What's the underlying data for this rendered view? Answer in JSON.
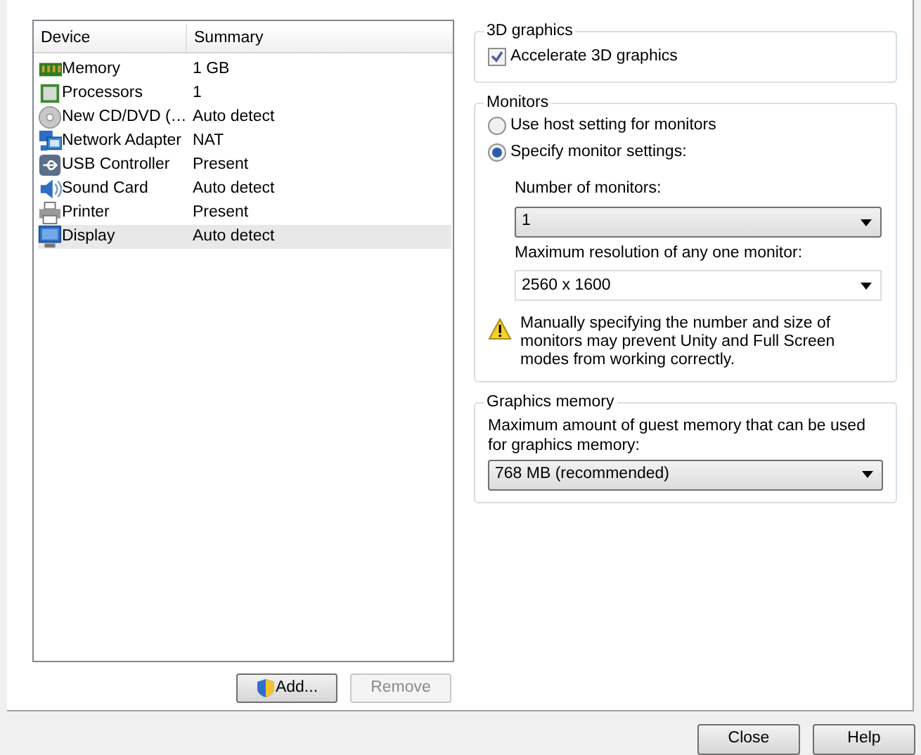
{
  "device_list": {
    "columns": [
      "Device",
      "Summary"
    ],
    "rows": [
      {
        "kind": "memory",
        "device": "Memory",
        "summary": "1 GB",
        "selected": false
      },
      {
        "kind": "processor",
        "device": "Processors",
        "summary": "1",
        "selected": false
      },
      {
        "kind": "cd",
        "device": "New CD/DVD (…",
        "summary": "Auto detect",
        "selected": false
      },
      {
        "kind": "network",
        "device": "Network Adapter",
        "summary": "NAT",
        "selected": false
      },
      {
        "kind": "usb",
        "device": "USB Controller",
        "summary": "Present",
        "selected": false
      },
      {
        "kind": "sound",
        "device": "Sound Card",
        "summary": "Auto detect",
        "selected": false
      },
      {
        "kind": "printer",
        "device": "Printer",
        "summary": "Present",
        "selected": false
      },
      {
        "kind": "display",
        "device": "Display",
        "summary": "Auto detect",
        "selected": true
      }
    ]
  },
  "list_buttons": [
    {
      "label": "Add...",
      "shield": true,
      "disabled": false
    },
    {
      "label": "Remove",
      "shield": false,
      "disabled": true
    }
  ],
  "graphics_3d": {
    "title": "3D graphics",
    "accelerate": {
      "label": "Accelerate 3D graphics",
      "checked": true
    }
  },
  "monitors": {
    "title": "Monitors",
    "options": [
      {
        "label": "Use host setting for monitors",
        "selected": false
      },
      {
        "label": "Specify monitor settings:",
        "selected": true
      }
    ],
    "number_label": "Number of monitors:",
    "number_value": "1",
    "resolution_label": "Maximum resolution of any one monitor:",
    "resolution_value": "2560 x 1600",
    "warning": "Manually specifying the number and size of monitors may prevent Unity and Full Screen modes from working correctly."
  },
  "graphics_memory": {
    "title": "Graphics memory",
    "label": "Maximum amount of guest memory that can be used for graphics memory:",
    "value": "768 MB (recommended)"
  },
  "dialog_buttons": [
    "Close",
    "Help"
  ]
}
